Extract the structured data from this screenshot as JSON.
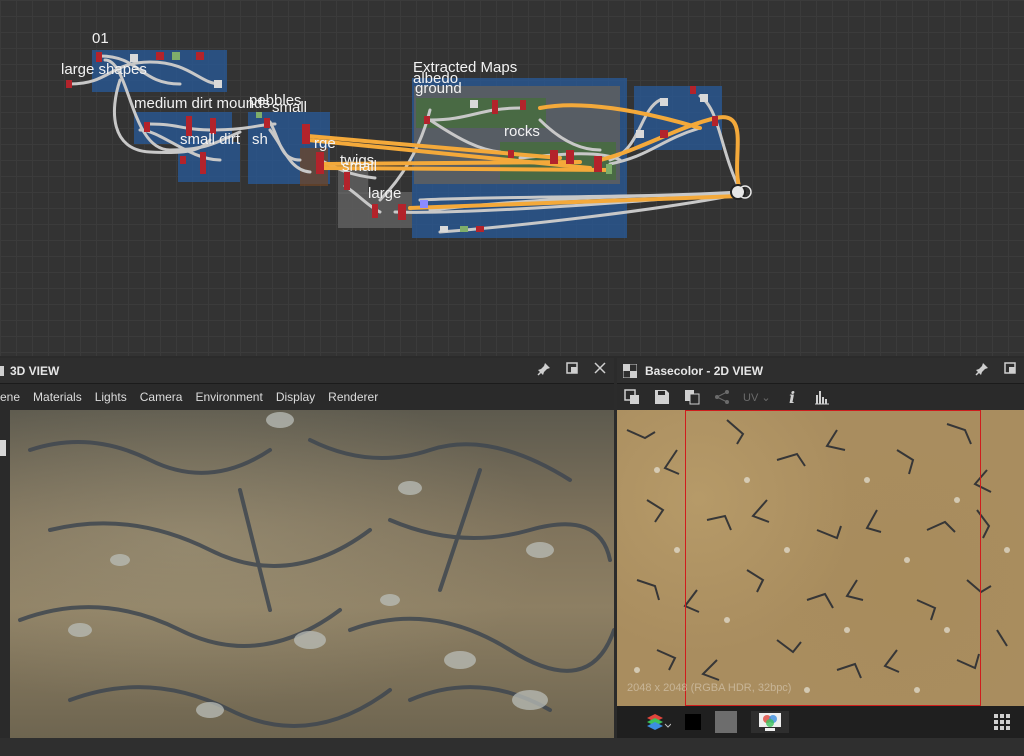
{
  "graph": {
    "frames": [
      {
        "title": "01"
      },
      {
        "title": "large shapes"
      },
      {
        "title": "medium dirt mounds"
      },
      {
        "title": "pebbles"
      },
      {
        "title": "small"
      },
      {
        "title": "small dirt"
      },
      {
        "title": "sh"
      },
      {
        "title": "rge"
      },
      {
        "title": "twigs"
      },
      {
        "title": "small"
      },
      {
        "title": "large"
      },
      {
        "title": "Extracted Maps"
      },
      {
        "title": "albedo"
      },
      {
        "title": "ground"
      },
      {
        "title": "rocks"
      }
    ]
  },
  "panel3d": {
    "title": "3D VIEW",
    "menu": [
      "ene",
      "Materials",
      "Lights",
      "Camera",
      "Environment",
      "Display",
      "Renderer"
    ],
    "icons": [
      "pin-icon",
      "maximize-icon",
      "close-icon"
    ]
  },
  "panel2d": {
    "title": "Basecolor - 2D VIEW",
    "uv_label": "UV",
    "info_glyph": "i",
    "resolution": "2048 x 2048 (RGBA HDR, 32bpc)",
    "icons": [
      "pin-icon",
      "maximize-icon"
    ]
  },
  "colors": {
    "wire_orange": "#f4a93a",
    "wire_grey": "#c8c8c8",
    "frame_blue": "#2a5896",
    "tile_border": "#d01c1c"
  }
}
